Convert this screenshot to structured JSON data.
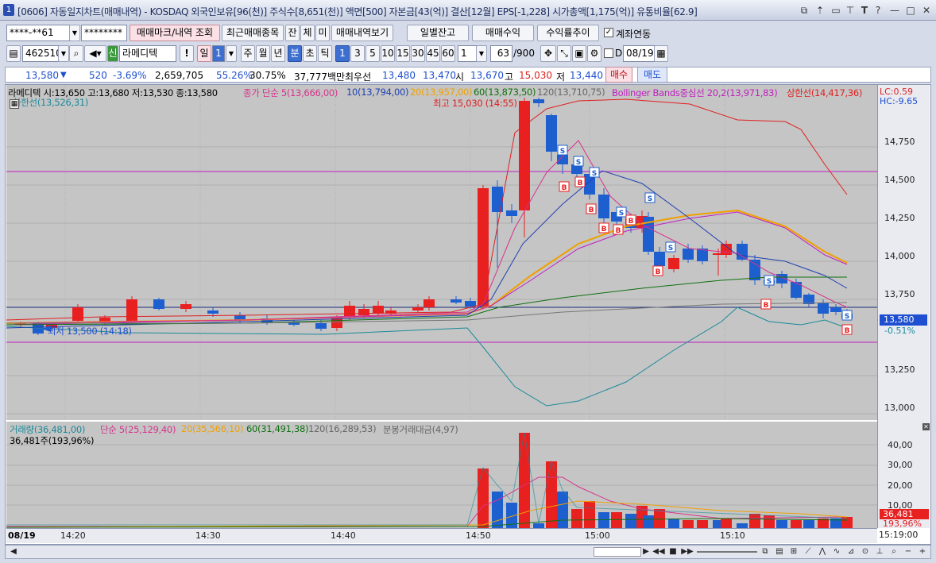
{
  "window": {
    "num": "1",
    "title": "[0606] 자동일지차트(매매내역) - KOSDAQ 외국인보유[96(천)] 주식수[8,651(천)] 액면[500] 자본금[43(억)] 결산[12월] EPS[-1,228] 시가총액[1,175(억)] 유통비율[62.9]"
  },
  "toolbar1": {
    "account": "****-**61",
    "password": "********",
    "trade_mark_btn": "매매마크/내역 조회",
    "recent_btn": "최근매매종목",
    "jan": "잔",
    "che": "체",
    "mi": "미",
    "history_btn": "매매내역보기",
    "daily_btn": "일별잔고",
    "profit_btn": "매매수익",
    "return_btn": "수익률추이",
    "link_label": "계좌연동"
  },
  "toolbar2": {
    "code": "462510",
    "sin": "신",
    "name": "라메디텍",
    "excl": "!",
    "il": "일",
    "il_num": "1",
    "ju": "주",
    "wol": "월",
    "nyeon": "년",
    "bun": "분",
    "cho": "초",
    "tik": "틱",
    "intervals": [
      "1",
      "3",
      "5",
      "10",
      "15",
      "30",
      "45",
      "60"
    ],
    "count": "1",
    "bars": "63",
    "bars_total": "/900",
    "date_d": "D",
    "date": "08/19"
  },
  "quote": {
    "price": "13,580",
    "arrow": "▼",
    "change": "520",
    "change_pct": "-3.69%",
    "volume": "2,659,705",
    "vol_ratio": "55.26%",
    "rate2": "30.75%",
    "amount": "37,777백만",
    "preferred_label": "최우선",
    "ask": "13,480",
    "bid": "13,470",
    "open_label": "시",
    "open": "13,670",
    "high_label": "고",
    "high": "15,030",
    "low_label": "저",
    "low": "13,440",
    "buy": "매수",
    "sell": "매도"
  },
  "legend": {
    "name": "라메디텍",
    "ohlc": "시:13,650 고:13,680 저:13,530 종:13,580",
    "ma5": "종가 단순 5(13,666,00)",
    "ma10": "10(13,794,00)",
    "ma20": "20(13,957,00)",
    "ma60": "60(13,873,50)",
    "ma120": "120(13,710,75)",
    "bb": "Bollinger Bands중심선 20,2(13,971,83)",
    "upper": "상한선(14,417,36)",
    "lower": "하한선(13,526,31)",
    "lc": "LC:0.59",
    "hc": "HC:-9.65",
    "max": "최고 15,030 (14:55)",
    "min": "최저 13,500 (14:18)"
  },
  "vol_legend": {
    "vol": "거래량(36,481,00)",
    "ma5": "단순 5(25,129,40)",
    "ma20": "20(35,566,10)",
    "ma60": "60(31,491,38)",
    "ma120": "120(16,289,53)",
    "amt": "분봉거래대금(4,97)",
    "cur": "36,481주(193,96%)"
  },
  "y_labels": [
    "14,750",
    "14,500",
    "14,250",
    "14,000",
    "13,750",
    "13,250",
    "13,000"
  ],
  "y_tags": {
    "price": "13,580",
    "pct": "-0.51%"
  },
  "vol_y_labels": [
    "40,00",
    "30,00",
    "20,00",
    "10,00"
  ],
  "vol_tags": {
    "v": "36,481",
    "p": "193,96%"
  },
  "x_labels": {
    "date": "08/19",
    "t1": "14:20",
    "t2": "14:30",
    "t3": "14:40",
    "t4": "14:50",
    "t5": "15:00",
    "t6": "15:10",
    "end": "15:19:00"
  },
  "colors": {
    "up": "#e82020",
    "down": "#1e5fd0",
    "bg": "#c5c5c5"
  }
}
